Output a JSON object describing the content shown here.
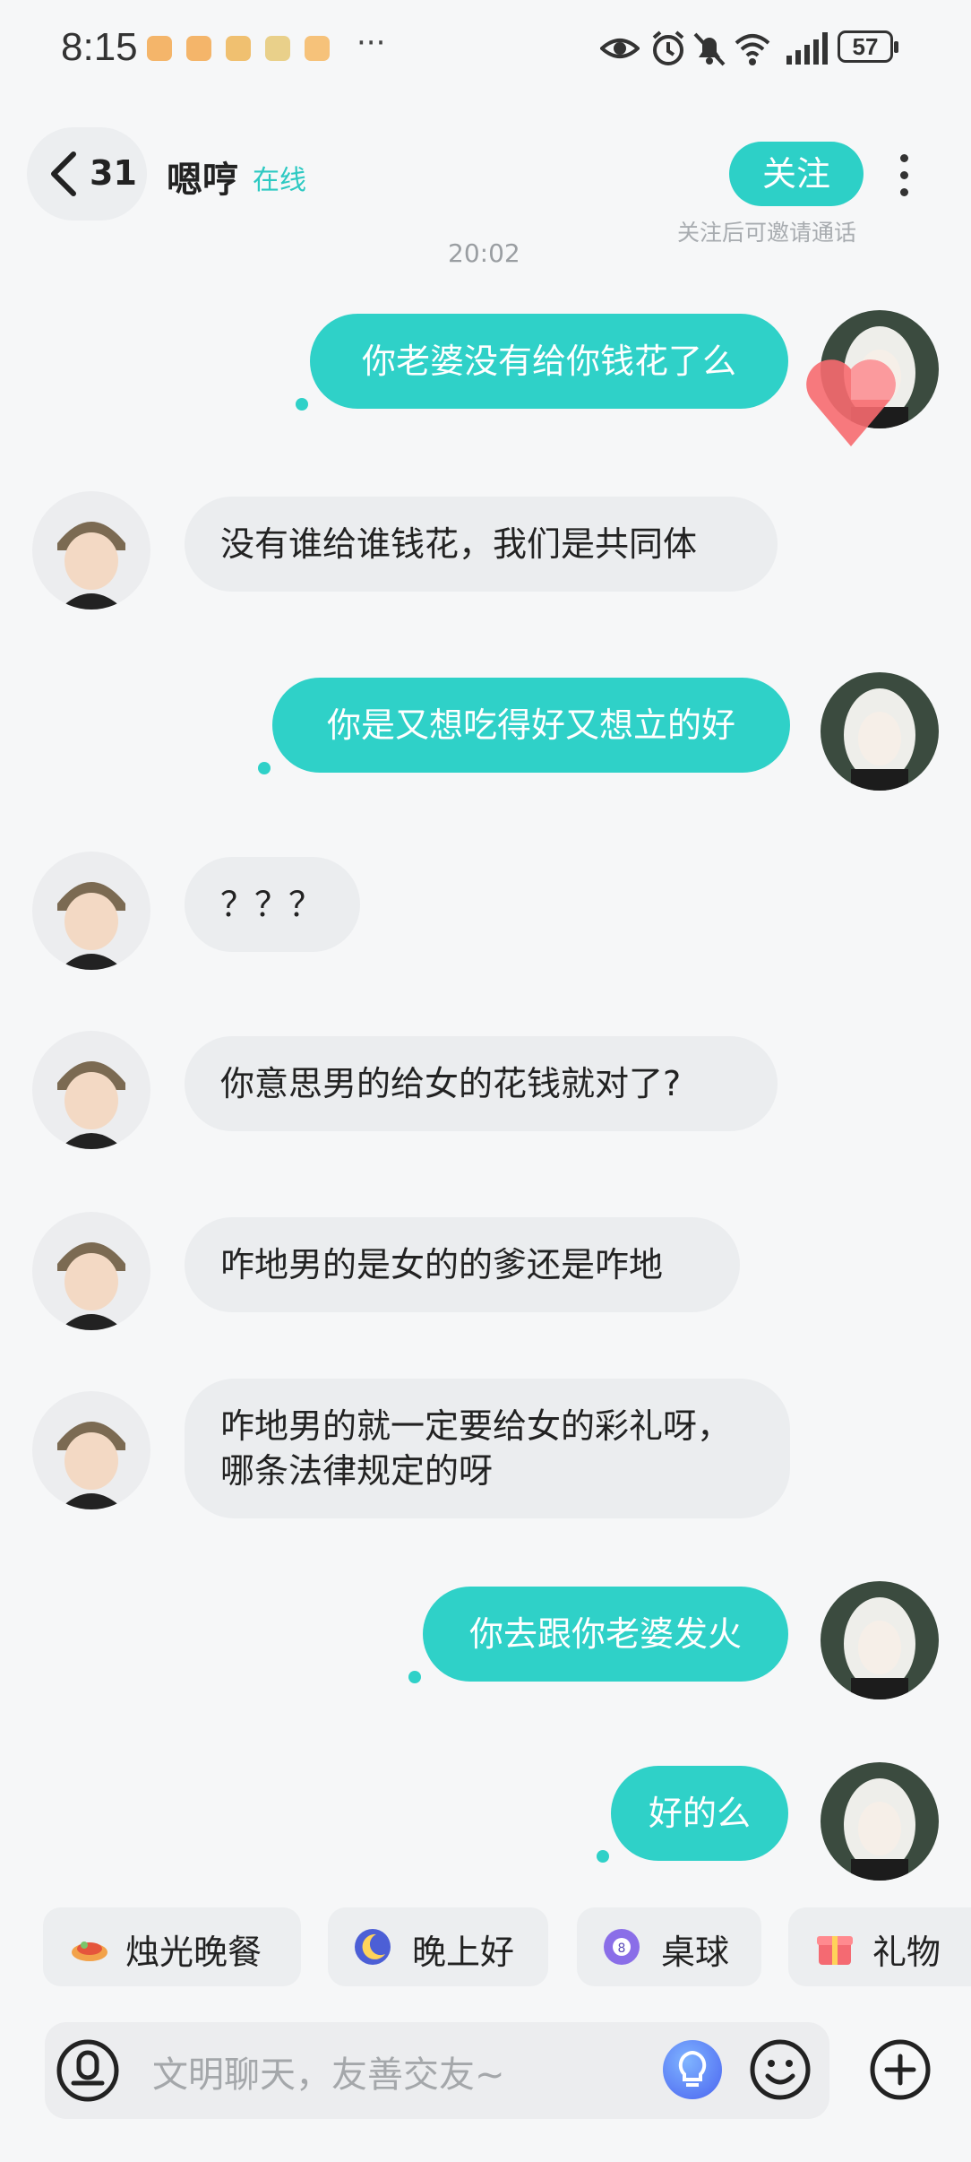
{
  "status_bar": {
    "time": "8:15",
    "more": "···",
    "battery": "57"
  },
  "header": {
    "back_count": "31",
    "name": "嗯哼",
    "online_status": "在线",
    "follow_label": "关注",
    "follow_hint": "关注后可邀请通话"
  },
  "timestamp": "20:02",
  "messages": [
    {
      "side": "out",
      "text": "你老婆没有给你钱花了么"
    },
    {
      "side": "in",
      "text": "没有谁给谁钱花，我们是共同体"
    },
    {
      "side": "out",
      "text": "你是又想吃得好又想立的好"
    },
    {
      "side": "in",
      "text": "？？？"
    },
    {
      "side": "in",
      "text": "你意思男的给女的花钱就对了?"
    },
    {
      "side": "in",
      "text": "咋地男的是女的的爹还是咋地"
    },
    {
      "side": "in",
      "text": "咋地男的就一定要给女的彩礼呀，哪条法律规定的呀"
    },
    {
      "side": "out",
      "text": "你去跟你老婆发火"
    },
    {
      "side": "out",
      "text": "好的么"
    }
  ],
  "quick_replies": [
    {
      "label": "烛光晚餐",
      "icon": "candlelight-dinner-icon"
    },
    {
      "label": "晚上好",
      "icon": "moon-icon"
    },
    {
      "label": "桌球",
      "icon": "billiard-ball-icon"
    },
    {
      "label": "礼物",
      "icon": "gift-icon"
    }
  ],
  "input": {
    "placeholder": "文明聊天，友善交友~"
  },
  "colors": {
    "accent": "#2fd1c8",
    "incoming_bubble": "#ebedef",
    "background": "#f6f7f8"
  }
}
